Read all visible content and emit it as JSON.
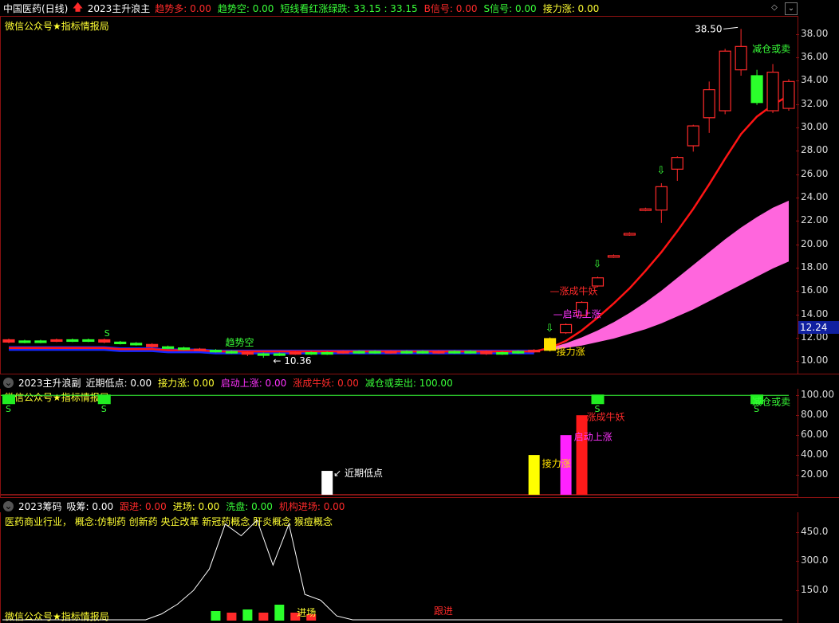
{
  "main_panel": {
    "header": {
      "stock": "中国医药(日线)",
      "arrow": "up-arrow-icon",
      "indicator": "2023主升浪主",
      "values": [
        {
          "label": "趋势多: 0.00",
          "color": "#ff2a2a"
        },
        {
          "label": "趋势空: 0.00",
          "color": "#39ff39"
        },
        {
          "label": "短线看红涨绿跌: 33.15 : 33.15",
          "color": "#39ff39"
        },
        {
          "label": "B信号: 0.00",
          "color": "#ff2a2a"
        },
        {
          "label": "S信号: 0.00",
          "color": "#39ff39"
        },
        {
          "label": "接力涨: 0.00",
          "color": "#ffff33"
        }
      ]
    },
    "watermark": "微信公众号★指标情报局",
    "price_axis": [
      "38.00",
      "36.00",
      "34.00",
      "32.00",
      "30.00",
      "28.00",
      "26.00",
      "24.00",
      "22.00",
      "20.00",
      "18.00",
      "16.00",
      "14.00",
      "12.00",
      "10.00"
    ],
    "current_price": "12.24",
    "annotations": {
      "high": "38.50",
      "low": "10.36",
      "reduce_sell": "减仓或卖",
      "bull_demon": "涨成牛妖",
      "start_rise": "启动上涨",
      "relay_rise": "接力涨",
      "trend_empty": "趋势空",
      "relay_short": "接力涨"
    }
  },
  "sub_panel": {
    "header": {
      "indicator": "2023主升浪副",
      "values": [
        {
          "label": "近期低点: 0.00",
          "color": "#ffffff"
        },
        {
          "label": "接力涨: 0.00",
          "color": "#ffff33"
        },
        {
          "label": "启动上涨: 0.00",
          "color": "#ff33ff"
        },
        {
          "label": "涨成牛妖: 0.00",
          "color": "#ff2a2a"
        },
        {
          "label": "减仓或卖出: 100.00",
          "color": "#39ff39"
        }
      ]
    },
    "watermark": "微信公众号★指标情报局",
    "axis": [
      "100.00",
      "80.00",
      "60.00",
      "40.00",
      "20.00"
    ],
    "labels": {
      "recent_low": "近期低点",
      "relay": "接力涨",
      "start": "启动上涨",
      "bull": "涨成牛妖",
      "reduce": "减仓或卖",
      "s_mark": "S"
    }
  },
  "chip_panel": {
    "header": {
      "indicator": "2023筹码",
      "values": [
        {
          "label": "吸筹: 0.00",
          "color": "#ffffff"
        },
        {
          "label": "跟进: 0.00",
          "color": "#ff2a2a"
        },
        {
          "label": "进场: 0.00",
          "color": "#ffff33"
        },
        {
          "label": "洗盘: 0.00",
          "color": "#39ff39"
        },
        {
          "label": "机构进场: 0.00",
          "color": "#ff2a2a"
        }
      ]
    },
    "concept_line": "医药商业行业， 概念:仿制药 创新药 央企改革 新冠药概念 肝炎概念 猴痘概念",
    "watermark": "微信公众号★指标情报局",
    "axis": [
      "450.0",
      "300.0",
      "150.0"
    ],
    "labels": {
      "follow": "跟进",
      "enter": "进场"
    }
  },
  "chart_data": [
    {
      "type": "candlestick",
      "title": "2023主升浪主",
      "ylim": [
        9.0,
        39.0
      ],
      "y_ticks": [
        10,
        12,
        14,
        16,
        18,
        20,
        22,
        24,
        26,
        28,
        30,
        32,
        34,
        36,
        38
      ],
      "candles": [
        {
          "i": 0,
          "o": 11.7,
          "c": 11.9,
          "h": 12.0,
          "l": 11.6
        },
        {
          "i": 1,
          "o": 11.8,
          "c": 11.7,
          "h": 11.9,
          "l": 11.6
        },
        {
          "i": 2,
          "o": 11.7,
          "c": 11.8,
          "h": 11.9,
          "l": 11.6
        },
        {
          "i": 3,
          "o": 11.8,
          "c": 11.9,
          "h": 12.0,
          "l": 11.7
        },
        {
          "i": 4,
          "o": 11.9,
          "c": 11.8,
          "h": 12.0,
          "l": 11.7
        },
        {
          "i": 5,
          "o": 11.8,
          "c": 11.9,
          "h": 12.0,
          "l": 11.7
        },
        {
          "i": 6,
          "o": 11.9,
          "c": 11.7,
          "h": 12.0,
          "l": 11.6
        },
        {
          "i": 7,
          "o": 11.7,
          "c": 11.6,
          "h": 11.8,
          "l": 11.5
        },
        {
          "i": 8,
          "o": 11.6,
          "c": 11.5,
          "h": 11.7,
          "l": 11.4
        },
        {
          "i": 9,
          "o": 11.5,
          "c": 11.3,
          "h": 11.6,
          "l": 11.2
        },
        {
          "i": 10,
          "o": 11.3,
          "c": 11.2,
          "h": 11.4,
          "l": 11.1
        },
        {
          "i": 11,
          "o": 11.2,
          "c": 11.1,
          "h": 11.3,
          "l": 11.0
        },
        {
          "i": 12,
          "o": 11.1,
          "c": 11.0,
          "h": 11.2,
          "l": 10.9
        },
        {
          "i": 13,
          "o": 11.0,
          "c": 10.9,
          "h": 11.1,
          "l": 10.8
        },
        {
          "i": 14,
          "o": 10.9,
          "c": 10.8,
          "h": 11.0,
          "l": 10.7
        },
        {
          "i": 15,
          "o": 10.8,
          "c": 10.7,
          "h": 10.9,
          "l": 10.5
        },
        {
          "i": 16,
          "o": 10.7,
          "c": 10.6,
          "h": 10.8,
          "l": 10.36
        },
        {
          "i": 17,
          "o": 10.6,
          "c": 10.7,
          "h": 10.8,
          "l": 10.5
        },
        {
          "i": 18,
          "o": 10.7,
          "c": 10.8,
          "h": 10.9,
          "l": 10.6
        },
        {
          "i": 19,
          "o": 10.8,
          "c": 10.7,
          "h": 10.9,
          "l": 10.6
        },
        {
          "i": 20,
          "o": 10.7,
          "c": 10.8,
          "h": 10.9,
          "l": 10.6
        },
        {
          "i": 21,
          "o": 10.8,
          "c": 10.9,
          "h": 11.0,
          "l": 10.7
        },
        {
          "i": 22,
          "o": 10.9,
          "c": 10.8,
          "h": 11.0,
          "l": 10.7
        },
        {
          "i": 23,
          "o": 10.8,
          "c": 10.9,
          "h": 11.0,
          "l": 10.7
        },
        {
          "i": 24,
          "o": 10.9,
          "c": 10.8,
          "h": 11.0,
          "l": 10.7
        },
        {
          "i": 25,
          "o": 10.8,
          "c": 10.9,
          "h": 11.0,
          "l": 10.7
        },
        {
          "i": 26,
          "o": 10.9,
          "c": 10.8,
          "h": 11.0,
          "l": 10.7
        },
        {
          "i": 27,
          "o": 10.8,
          "c": 10.9,
          "h": 11.0,
          "l": 10.7
        },
        {
          "i": 28,
          "o": 10.9,
          "c": 10.8,
          "h": 11.0,
          "l": 10.7
        },
        {
          "i": 29,
          "o": 10.8,
          "c": 10.9,
          "h": 11.0,
          "l": 10.7
        },
        {
          "i": 30,
          "o": 10.9,
          "c": 10.7,
          "h": 11.0,
          "l": 10.6
        },
        {
          "i": 31,
          "o": 10.7,
          "c": 10.8,
          "h": 10.9,
          "l": 10.6
        },
        {
          "i": 32,
          "o": 10.8,
          "c": 10.9,
          "h": 11.0,
          "l": 10.7
        },
        {
          "i": 33,
          "o": 10.9,
          "c": 11.0,
          "h": 11.1,
          "l": 10.8
        },
        {
          "i": 34,
          "o": 11.0,
          "c": 12.0,
          "h": 12.1,
          "l": 10.9
        },
        {
          "i": 35,
          "o": 12.5,
          "c": 13.2,
          "h": 13.3,
          "l": 12.4
        },
        {
          "i": 36,
          "o": 14.0,
          "c": 15.1,
          "h": 15.2,
          "l": 13.9
        },
        {
          "i": 37,
          "o": 16.5,
          "c": 17.2,
          "h": 17.3,
          "l": 16.4
        },
        {
          "i": 38,
          "o": 19.0,
          "c": 19.1,
          "h": 19.2,
          "l": 18.9
        },
        {
          "i": 39,
          "o": 20.9,
          "c": 21.0,
          "h": 21.1,
          "l": 20.8
        },
        {
          "i": 40,
          "o": 23.0,
          "c": 23.1,
          "h": 23.2,
          "l": 22.9
        },
        {
          "i": 41,
          "o": 23.0,
          "c": 25.0,
          "h": 25.3,
          "l": 21.9
        },
        {
          "i": 42,
          "o": 26.5,
          "c": 27.5,
          "h": 27.6,
          "l": 25.5
        },
        {
          "i": 43,
          "o": 28.5,
          "c": 30.2,
          "h": 30.3,
          "l": 28.0
        },
        {
          "i": 44,
          "o": 30.9,
          "c": 33.3,
          "h": 34.0,
          "l": 29.6
        },
        {
          "i": 45,
          "o": 31.5,
          "c": 36.6,
          "h": 36.8,
          "l": 31.2
        },
        {
          "i": 46,
          "o": 35.0,
          "c": 37.0,
          "h": 38.5,
          "l": 34.5
        },
        {
          "i": 47,
          "o": 34.5,
          "c": 32.2,
          "h": 35.0,
          "l": 32.0
        },
        {
          "i": 48,
          "o": 31.5,
          "c": 34.8,
          "h": 35.5,
          "l": 31.3
        },
        {
          "i": 49,
          "o": 31.7,
          "c": 34.0,
          "h": 34.2,
          "l": 31.5
        }
      ],
      "trend_line": [
        11.2,
        11.2,
        11.2,
        11.2,
        11.2,
        11.2,
        11.2,
        11.1,
        11.1,
        11.1,
        11.0,
        11.0,
        11.0,
        10.9,
        10.9,
        10.9,
        10.9,
        10.9,
        10.9,
        10.9,
        10.9,
        10.9,
        10.9,
        10.9,
        10.9,
        10.9,
        10.9,
        10.9,
        10.9,
        10.9,
        10.9,
        10.9,
        10.9,
        10.9,
        11.2,
        11.8,
        12.7,
        13.8,
        15.0,
        16.3,
        17.8,
        19.4,
        21.2,
        23.1,
        25.2,
        27.4,
        29.5,
        31.0,
        32.0,
        32.8
      ],
      "band_upper": [
        null,
        null,
        null,
        null,
        null,
        null,
        null,
        null,
        null,
        null,
        null,
        null,
        null,
        null,
        null,
        null,
        null,
        null,
        null,
        null,
        null,
        null,
        null,
        null,
        null,
        null,
        null,
        null,
        null,
        null,
        null,
        null,
        null,
        null,
        11.2,
        11.6,
        12.1,
        12.7,
        13.4,
        14.2,
        15.1,
        16.1,
        17.2,
        18.3,
        19.4,
        20.5,
        21.5,
        22.4,
        23.2,
        23.8
      ],
      "band_lower": [
        null,
        null,
        null,
        null,
        null,
        null,
        null,
        null,
        null,
        null,
        null,
        null,
        null,
        null,
        null,
        null,
        null,
        null,
        null,
        null,
        null,
        null,
        null,
        null,
        null,
        null,
        null,
        null,
        null,
        null,
        null,
        null,
        null,
        null,
        11.0,
        11.2,
        11.4,
        11.7,
        12.0,
        12.4,
        12.8,
        13.3,
        13.9,
        14.5,
        15.2,
        15.9,
        16.6,
        17.3,
        18.0,
        18.6
      ]
    },
    {
      "type": "bar",
      "title": "2023主升浪副",
      "ylim": [
        0,
        105
      ],
      "series": [
        {
          "name": "近期低点",
          "values": [
            {
              "i": 20,
              "v": 24
            }
          ]
        },
        {
          "name": "接力涨",
          "values": [
            {
              "i": 33,
              "v": 40
            }
          ]
        },
        {
          "name": "启动上涨",
          "values": [
            {
              "i": 35,
              "v": 60
            }
          ]
        },
        {
          "name": "涨成牛妖",
          "values": [
            {
              "i": 36,
              "v": 80
            }
          ]
        },
        {
          "name": "减仓或卖出",
          "values": [
            {
              "i": 0,
              "v": 100
            },
            {
              "i": 6,
              "v": 100
            },
            {
              "i": 37,
              "v": 100
            },
            {
              "i": 47,
              "v": 100
            }
          ]
        }
      ]
    },
    {
      "type": "line",
      "title": "2023筹码",
      "ylim": [
        0,
        600
      ],
      "y_ticks": [
        150,
        300,
        450
      ],
      "line": [
        0,
        0,
        0,
        0,
        0,
        0,
        0,
        0,
        0,
        0,
        30,
        80,
        150,
        260,
        490,
        430,
        510,
        280,
        490,
        130,
        100,
        20,
        0,
        0,
        0,
        0,
        0,
        0,
        0,
        0,
        0,
        0,
        0,
        0,
        0,
        0,
        0,
        0,
        0,
        0,
        0,
        0,
        0,
        0,
        0,
        0,
        0,
        0,
        0,
        0
      ]
    }
  ]
}
